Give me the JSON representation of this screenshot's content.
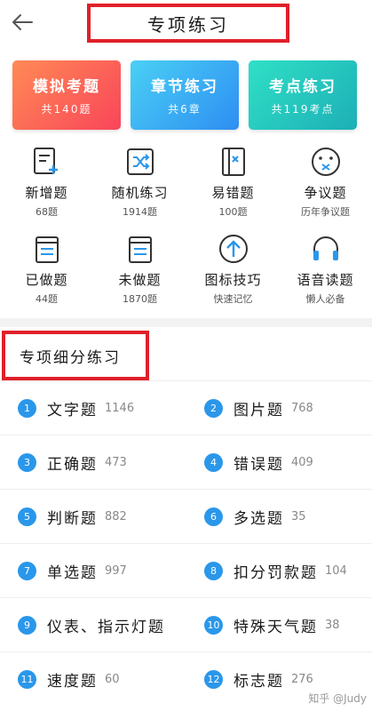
{
  "header": {
    "title": "专项练习"
  },
  "cards": [
    {
      "title": "模拟考题",
      "sub": "共140题"
    },
    {
      "title": "章节练习",
      "sub": "共6章"
    },
    {
      "title": "考点练习",
      "sub": "共119考点"
    }
  ],
  "grid": [
    {
      "label": "新增题",
      "sub": "68题",
      "icon": "add-document-icon"
    },
    {
      "label": "随机练习",
      "sub": "1914题",
      "icon": "shuffle-icon"
    },
    {
      "label": "易错题",
      "sub": "100题",
      "icon": "wrong-book-icon"
    },
    {
      "label": "争议题",
      "sub": "历年争议题",
      "icon": "dispute-face-icon"
    },
    {
      "label": "已做题",
      "sub": "44题",
      "icon": "done-list-icon"
    },
    {
      "label": "未做题",
      "sub": "1870题",
      "icon": "undone-list-icon"
    },
    {
      "label": "图标技巧",
      "sub": "快速记忆",
      "icon": "up-arrow-icon"
    },
    {
      "label": "语音读题",
      "sub": "懒人必备",
      "icon": "headphones-icon"
    }
  ],
  "section": {
    "title": "专项细分练习"
  },
  "list": [
    {
      "num": "1",
      "name": "文字题",
      "count": "1146"
    },
    {
      "num": "2",
      "name": "图片题",
      "count": "768"
    },
    {
      "num": "3",
      "name": "正确题",
      "count": "473"
    },
    {
      "num": "4",
      "name": "错误题",
      "count": "409"
    },
    {
      "num": "5",
      "name": "判断题",
      "count": "882"
    },
    {
      "num": "6",
      "name": "多选题",
      "count": "35"
    },
    {
      "num": "7",
      "name": "单选题",
      "count": "997"
    },
    {
      "num": "8",
      "name": "扣分罚款题",
      "count": "104"
    },
    {
      "num": "9",
      "name": "仪表、指示灯题",
      "count": ""
    },
    {
      "num": "10",
      "name": "特殊天气题",
      "count": "38"
    },
    {
      "num": "11",
      "name": "速度题",
      "count": "60"
    },
    {
      "num": "12",
      "name": "标志题",
      "count": "276"
    }
  ],
  "watermark": "知乎 @Judy",
  "colors": {
    "accent": "#2a97ea",
    "highlight": "#e0202a"
  }
}
